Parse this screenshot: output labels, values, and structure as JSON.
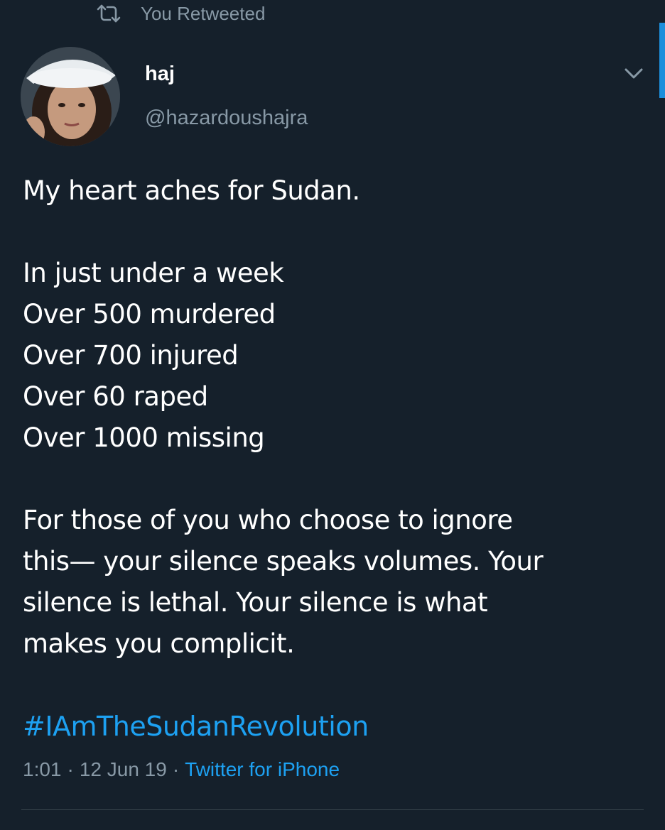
{
  "retweet_banner": {
    "icon": "retweet-icon",
    "label": "You Retweeted"
  },
  "author": {
    "display_name": "haj",
    "handle": "@hazardoushajra",
    "avatar_icon": "profile-photo"
  },
  "menu": {
    "icon": "chevron-down-icon"
  },
  "tweet": {
    "line_1": "My heart aches for Sudan.",
    "stats": [
      "In just under a week",
      "Over 500 murdered",
      "Over 700 injured",
      "Over 60 raped",
      "Over 1000 missing"
    ],
    "closing_lines": [
      "For those of you who choose to ignore",
      "this— your silence speaks volumes. Your",
      "silence is lethal. Your silence is what",
      "makes you complicit."
    ],
    "hashtag": "#IAmTheSudanRevolution"
  },
  "meta": {
    "time": "1:01",
    "separator": "·",
    "date": "12 Jun 19",
    "source": "Twitter for iPhone"
  },
  "colors": {
    "background": "#15202b",
    "text_primary": "#ffffff",
    "text_secondary": "#8899a6",
    "accent_link": "#1da1f2",
    "divider": "#38444d"
  }
}
